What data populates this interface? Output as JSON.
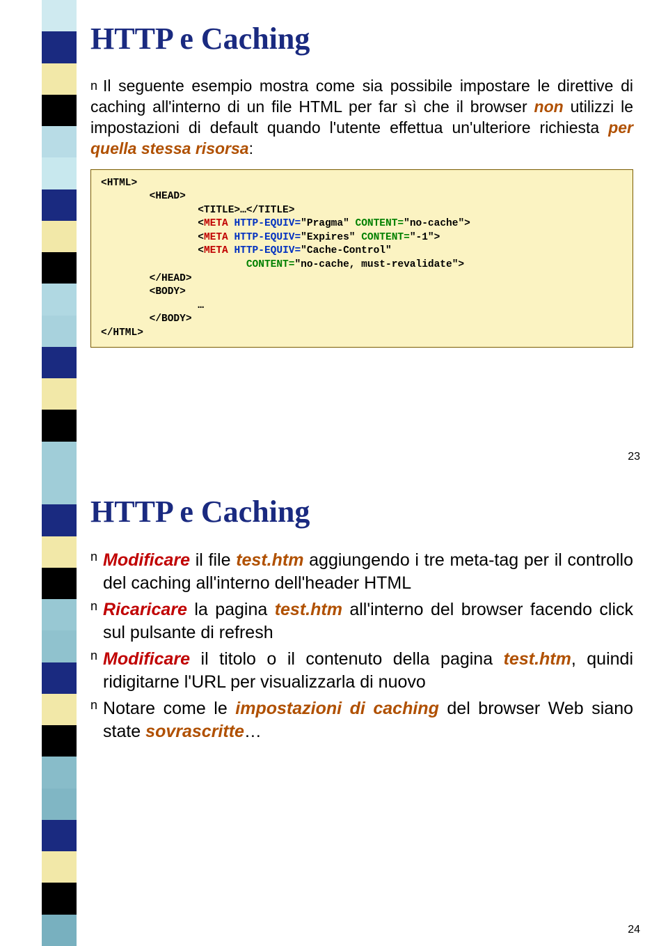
{
  "slide1": {
    "title": "HTTP e Caching",
    "intro_pre": "Il seguente esempio mostra come sia possibile impostare le direttive di caching all'interno di un file HTML per far sì che il browser ",
    "intro_non": "non",
    "intro_mid": " utilizzi le impostazioni di default quando l'utente effettua un'ulteriore richiesta ",
    "intro_per": "per quella stessa risorsa",
    "intro_end": ":",
    "code": {
      "l1": "<HTML>",
      "l2": "        <HEAD>",
      "l3a": "                <TITLE>…</TITLE>",
      "l4a": "                <",
      "meta": "META",
      "l4b": " ",
      "heq": "HTTP-EQUIV=",
      "l4c": "\"Pragma\" ",
      "cont": "CONTENT=",
      "l4d": "\"no-cache\">",
      "l5c": "\"Expires\" ",
      "l5d": "\"-1\">",
      "l6c": "\"Cache-Control\"",
      "l7a": "                        ",
      "l7d": "\"no-cache, must-revalidate\">",
      "l8": "        </HEAD>",
      "l9": "        <BODY>",
      "l10": "                …",
      "l11": "        </BODY>",
      "l12": "</HTML>"
    },
    "num": "23"
  },
  "slide2": {
    "title": "HTTP e Caching",
    "b1_a": "Modificare",
    "b1_b": " il file ",
    "b1_c": "test.htm",
    "b1_d": " aggiungendo i tre meta-tag per il controllo del caching all'interno dell'header HTML",
    "b2_a": "Ricaricare",
    "b2_b": " la pagina ",
    "b2_c": "test.htm",
    "b2_d": " all'interno del browser facendo click sul pulsante di refresh",
    "b3_a": "Modificare",
    "b3_b": " il titolo o il contenuto della pagina ",
    "b3_c": "test.htm",
    "b3_d": ", quindi ridigitarne l'URL per visualizzarla di nuovo",
    "b4_a": "Notare come le ",
    "b4_b": "impostazioni di caching",
    "b4_c": " del browser Web siano state ",
    "b4_d": "sovrascritte",
    "b4_e": "…",
    "num": "24"
  },
  "stripe1": [
    "#cfeaf0",
    "#1a2a80",
    "#f2e8a8",
    "#000",
    "#b8dce6",
    "#c8e8ee",
    "#1a2a80",
    "#f2e8a8",
    "#000",
    "#b0d8e2",
    "#a8d2dd",
    "#1a2a80",
    "#f2e8a8",
    "#000",
    "#a0cdd8"
  ],
  "stripe2": [
    "#a0cdd8",
    "#1a2a80",
    "#f2e8a8",
    "#000",
    "#98c8d3",
    "#90c2ce",
    "#1a2a80",
    "#f2e8a8",
    "#000",
    "#88bcc9",
    "#80b6c4",
    "#1a2a80",
    "#f2e8a8",
    "#000",
    "#78b0bf"
  ]
}
